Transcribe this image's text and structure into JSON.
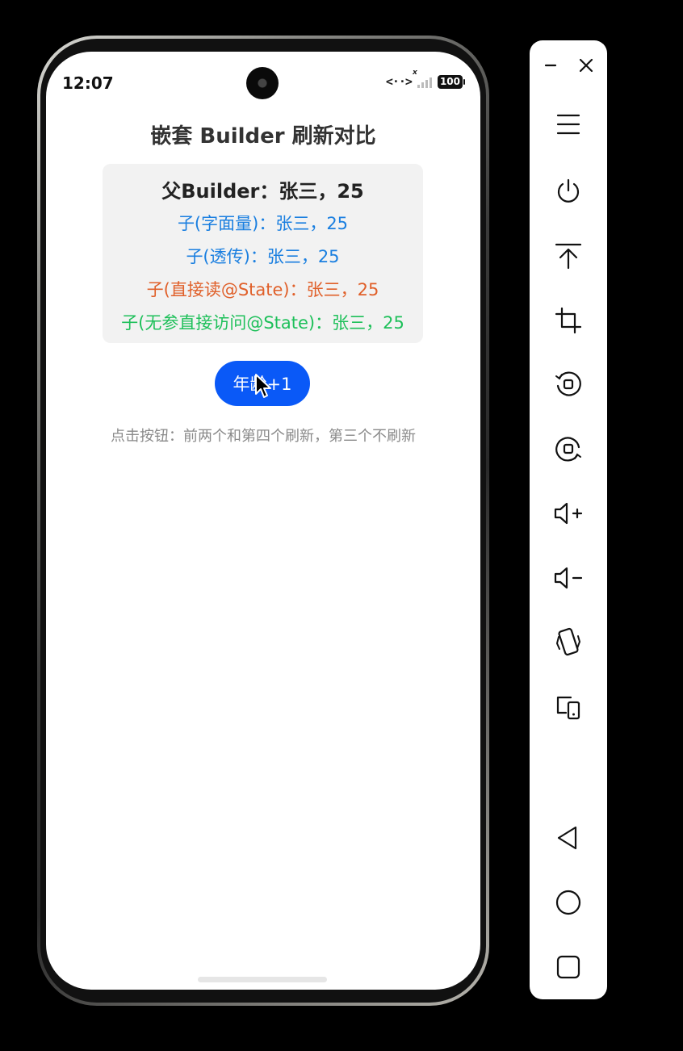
{
  "status_bar": {
    "time": "12:07",
    "network_label": "<··>",
    "signal_x": "x",
    "battery": "100"
  },
  "app": {
    "title": "嵌套 Builder 刷新对比",
    "parent_line": "父Builder：张三，25",
    "child_lines": [
      "子(字面量)：张三，25",
      "子(透传)：张三，25",
      "子(直接读@State)：张三，25",
      "子(无参直接访问@State)：张三，25"
    ],
    "button_label": "年龄+1",
    "hint": "点击按钮：前两个和第四个刷新，第三个不刷新"
  },
  "colors": {
    "accent_button": "#0a59f7",
    "child_blue": "#1a7fe0",
    "child_orange": "#e0602a",
    "child_green": "#1ec05a"
  },
  "toolbar": {
    "icons": [
      "minimize-icon",
      "close-icon",
      "menu-icon",
      "power-icon",
      "pin-top-icon",
      "crop-icon",
      "rotate-left-icon",
      "rotate-right-icon",
      "volume-up-icon",
      "volume-down-icon",
      "shake-icon",
      "multi-device-icon",
      "back-icon",
      "home-icon",
      "recents-icon"
    ]
  }
}
